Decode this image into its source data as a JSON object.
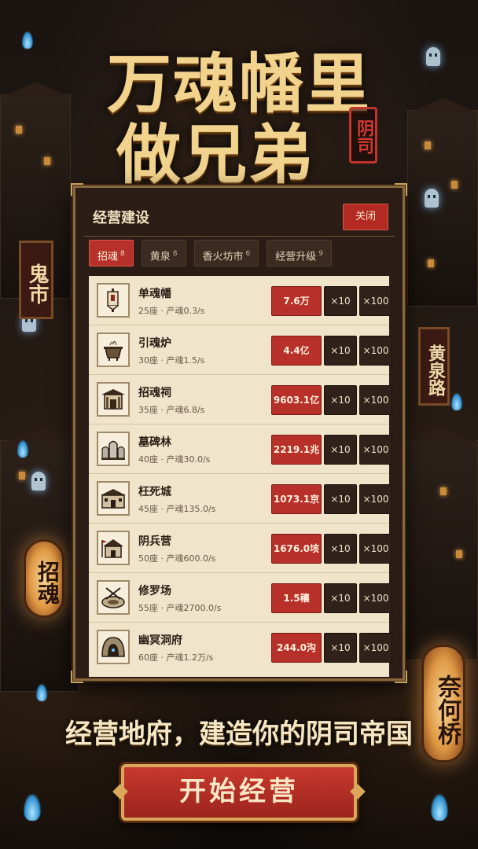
{
  "title": {
    "line1": "万魂幡里",
    "line2": "做兄弟",
    "seal": "阴司"
  },
  "signs": {
    "left": "鬼市",
    "right": "黄泉路",
    "lantern_left": "招魂",
    "lantern_right": "奈何桥"
  },
  "panel": {
    "title": "经营建设",
    "close_label": "关闭",
    "tabs": [
      {
        "label": "招魂",
        "count": "8"
      },
      {
        "label": "黄泉",
        "count": "8"
      },
      {
        "label": "香火坊市",
        "count": "6"
      },
      {
        "label": "经营升级",
        "count": "9"
      }
    ],
    "buildings": [
      {
        "name": "单魂幡",
        "info": "25座 · 产魂0.3/s",
        "price": "7.6万",
        "x10": "×10",
        "x100": "×100",
        "icon": "banner-icon"
      },
      {
        "name": "引魂炉",
        "info": "30座 · 产魂1.5/s",
        "price": "4.4亿",
        "x10": "×10",
        "x100": "×100",
        "icon": "cauldron-icon"
      },
      {
        "name": "招魂祠",
        "info": "35座 · 产魂6.8/s",
        "price": "9603.1亿",
        "x10": "×10",
        "x100": "×100",
        "icon": "shrine-icon"
      },
      {
        "name": "墓碑林",
        "info": "40座 · 产魂30.0/s",
        "price": "2219.1兆",
        "x10": "×10",
        "x100": "×100",
        "icon": "tombstone-icon"
      },
      {
        "name": "枉死城",
        "info": "45座 · 产魂135.0/s",
        "price": "1073.1京",
        "x10": "×10",
        "x100": "×100",
        "icon": "city-icon"
      },
      {
        "name": "阴兵营",
        "info": "50座 · 产魂600.0/s",
        "price": "1676.0垓",
        "x10": "×10",
        "x100": "×100",
        "icon": "barracks-icon"
      },
      {
        "name": "修罗场",
        "info": "55座 · 产魂2700.0/s",
        "price": "1.5穰",
        "x10": "×10",
        "x100": "×100",
        "icon": "arena-icon"
      },
      {
        "name": "幽冥洞府",
        "info": "60座 · 产魂1.2万/s",
        "price": "244.0沟",
        "x10": "×10",
        "x100": "×100",
        "icon": "cave-icon"
      }
    ]
  },
  "subtitle": "经营地府，建造你的阴司帝国",
  "cta_label": "开始经营",
  "colors": {
    "accent_red": "#b8302a",
    "gold": "#f2d38e",
    "panel_bg": "#2b1d15",
    "list_bg": "#f0e4cb"
  }
}
